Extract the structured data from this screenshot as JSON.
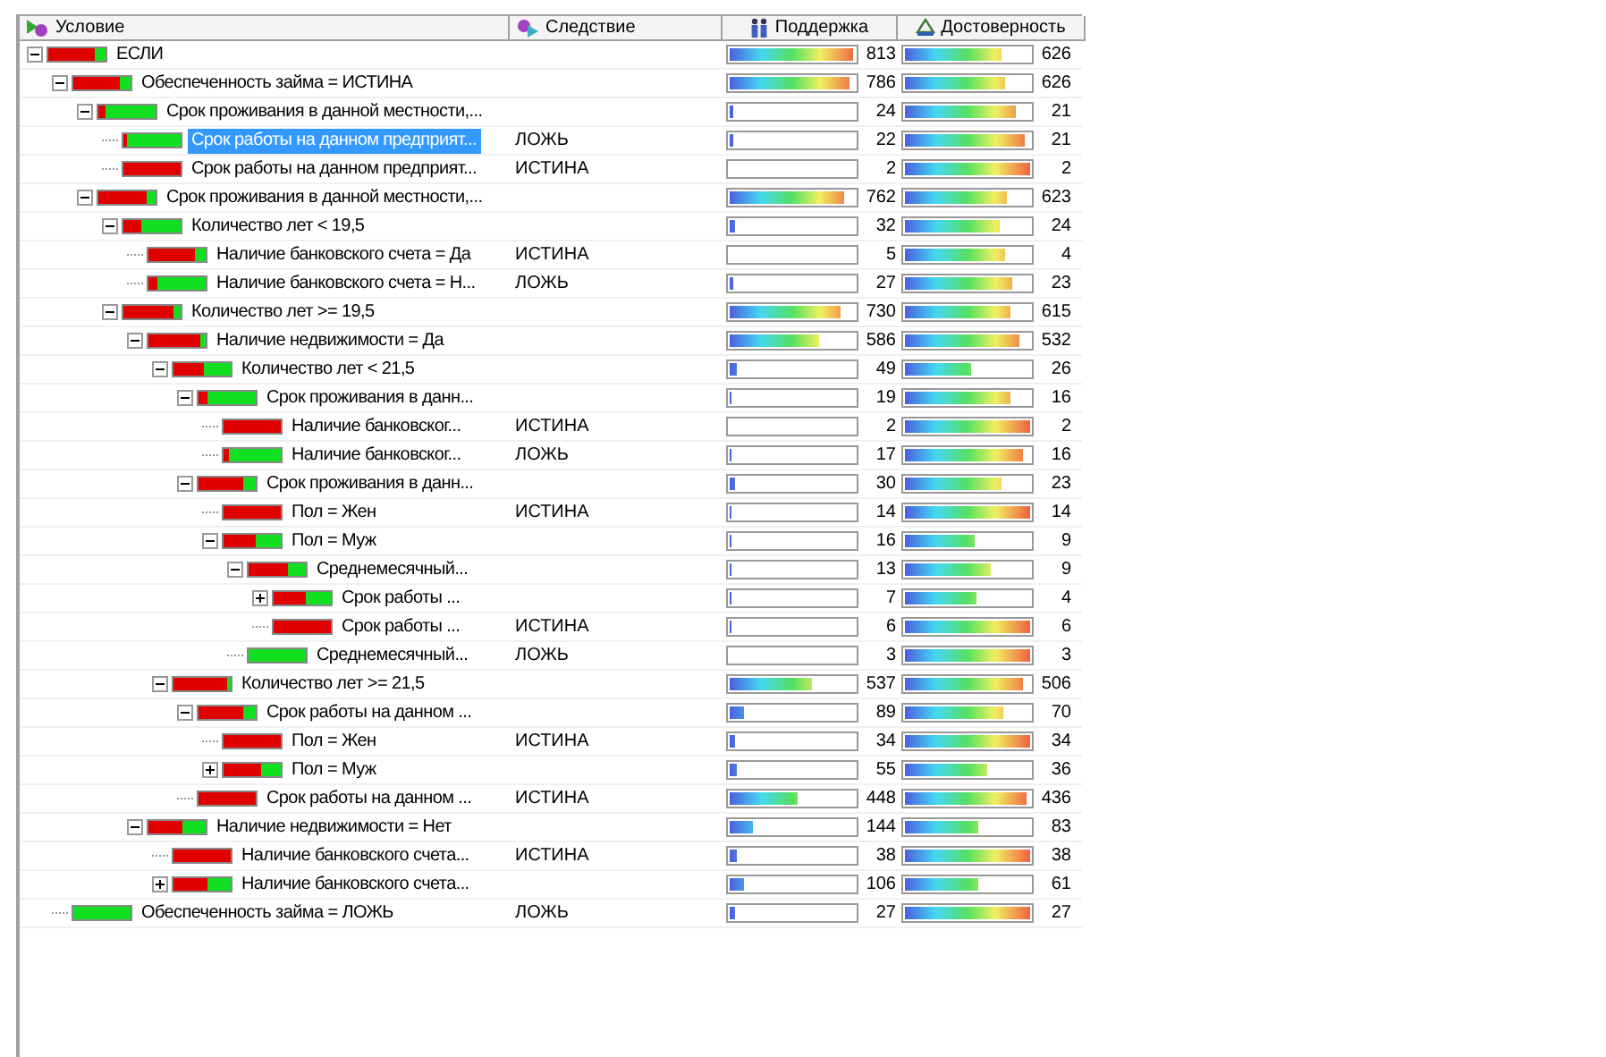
{
  "columns": [
    {
      "label": "Условие",
      "kind": "condition"
    },
    {
      "label": "Следствие",
      "kind": "consequence"
    },
    {
      "label": "Поддержка",
      "kind": "support"
    },
    {
      "label": "Достоверность",
      "kind": "confidence"
    }
  ],
  "tree": [
    {
      "label": "ЕСЛИ",
      "indicator": {
        "level": 0.8
      },
      "support": {
        "value": "813",
        "level": 0.98
      },
      "confidence": {
        "value": "626",
        "level": 0.77
      },
      "expanded": true,
      "selected": false,
      "children": [
        {
          "label": "Обеспеченность займа = ИСТИНА",
          "indicator": {
            "level": 0.82
          },
          "support": {
            "value": "786",
            "level": 0.95
          },
          "confidence": {
            "value": "626",
            "level": 0.8
          },
          "expanded": true,
          "selected": false,
          "children": [
            {
              "label": "Срок проживания в данной местности,...",
              "indicator": {
                "level": 0.12
              },
              "support": {
                "value": "24",
                "level": 0.03
              },
              "confidence": {
                "value": "21",
                "level": 0.88
              },
              "expanded": true,
              "selected": false,
              "children": [
                {
                  "label": "Срок работы на данном предприят...",
                  "consequence": "ЛОЖЬ",
                  "indicator": {
                    "level": 0.05
                  },
                  "support": {
                    "value": "22",
                    "level": 0.03
                  },
                  "confidence": {
                    "value": "21",
                    "level": 0.95
                  },
                  "selected": true
                },
                {
                  "label": "Срок работы на данном предприят...",
                  "consequence": "ИСТИНА",
                  "indicator": {
                    "level": 1
                  },
                  "support": {
                    "value": "2",
                    "level": 0
                  },
                  "confidence": {
                    "value": "2",
                    "level": 1
                  },
                  "selected": false
                }
              ]
            },
            {
              "label": "Срок проживания в данной местности,...",
              "indicator": {
                "level": 0.85
              },
              "support": {
                "value": "762",
                "level": 0.92
              },
              "confidence": {
                "value": "623",
                "level": 0.82
              },
              "expanded": true,
              "selected": false,
              "children": [
                {
                  "label": "Количество лет < 19,5",
                  "indicator": {
                    "level": 0.3
                  },
                  "support": {
                    "value": "32",
                    "level": 0.04
                  },
                  "confidence": {
                    "value": "24",
                    "level": 0.75
                  },
                  "expanded": true,
                  "selected": false,
                  "children": [
                    {
                      "label": "Наличие банковского счета = Да",
                      "consequence": "ИСТИНА",
                      "indicator": {
                        "level": 0.8
                      },
                      "support": {
                        "value": "5",
                        "level": 0
                      },
                      "confidence": {
                        "value": "4",
                        "level": 0.8
                      },
                      "selected": false
                    },
                    {
                      "label": "Наличие банковского счета = Н...",
                      "consequence": "ЛОЖЬ",
                      "indicator": {
                        "level": 0.15
                      },
                      "support": {
                        "value": "27",
                        "level": 0.03
                      },
                      "confidence": {
                        "value": "23",
                        "level": 0.85
                      },
                      "selected": false
                    }
                  ]
                },
                {
                  "label": "Количество лет >= 19,5",
                  "indicator": {
                    "level": 0.88
                  },
                  "support": {
                    "value": "730",
                    "level": 0.88
                  },
                  "confidence": {
                    "value": "615",
                    "level": 0.84
                  },
                  "expanded": true,
                  "selected": false,
                  "children": [
                    {
                      "label": "Наличие недвижимости = Да",
                      "indicator": {
                        "level": 0.92
                      },
                      "support": {
                        "value": "586",
                        "level": 0.72
                      },
                      "confidence": {
                        "value": "532",
                        "level": 0.91
                      },
                      "expanded": true,
                      "selected": false,
                      "children": [
                        {
                          "label": "Количество лет < 21,5",
                          "indicator": {
                            "level": 0.53
                          },
                          "support": {
                            "value": "49",
                            "level": 0.06
                          },
                          "confidence": {
                            "value": "26",
                            "level": 0.53
                          },
                          "expanded": true,
                          "selected": false,
                          "children": [
                            {
                              "label": "Срок проживания в данн...",
                              "indicator": {
                                "level": 0.16
                              },
                              "support": {
                                "value": "19",
                                "level": 0.02
                              },
                              "confidence": {
                                "value": "16",
                                "level": 0.84
                              },
                              "expanded": true,
                              "selected": false,
                              "children": [
                                {
                                  "label": "Наличие банковског...",
                                  "consequence": "ИСТИНА",
                                  "indicator": {
                                    "level": 1
                                  },
                                  "support": {
                                    "value": "2",
                                    "level": 0
                                  },
                                  "confidence": {
                                    "value": "2",
                                    "level": 1
                                  },
                                  "selected": false
                                },
                                {
                                  "label": "Наличие банковског...",
                                  "consequence": "ЛОЖЬ",
                                  "indicator": {
                                    "level": 0.08
                                  },
                                  "support": {
                                    "value": "17",
                                    "level": 0.02
                                  },
                                  "confidence": {
                                    "value": "16",
                                    "level": 0.94
                                  },
                                  "selected": false
                                }
                              ]
                            },
                            {
                              "label": "Срок проживания в данн...",
                              "indicator": {
                                "level": 0.77
                              },
                              "support": {
                                "value": "30",
                                "level": 0.04
                              },
                              "confidence": {
                                "value": "23",
                                "level": 0.77
                              },
                              "expanded": true,
                              "selected": false,
                              "children": [
                                {
                                  "label": "Пол = Жен",
                                  "consequence": "ИСТИНА",
                                  "indicator": {
                                    "level": 1
                                  },
                                  "support": {
                                    "value": "14",
                                    "level": 0.02
                                  },
                                  "confidence": {
                                    "value": "14",
                                    "level": 1
                                  },
                                  "selected": false
                                },
                                {
                                  "label": "Пол = Муж",
                                  "indicator": {
                                    "level": 0.56
                                  },
                                  "support": {
                                    "value": "16",
                                    "level": 0.02
                                  },
                                  "confidence": {
                                    "value": "9",
                                    "level": 0.56
                                  },
                                  "expanded": true,
                                  "selected": false,
                                  "children": [
                                    {
                                      "label": "Среднемесячный...",
                                      "indicator": {
                                        "level": 0.69
                                      },
                                      "support": {
                                        "value": "13",
                                        "level": 0.02
                                      },
                                      "confidence": {
                                        "value": "9",
                                        "level": 0.69
                                      },
                                      "expanded": true,
                                      "selected": false,
                                      "children": [
                                        {
                                          "label": "Срок работы ...",
                                          "indicator": {
                                            "level": 0.57
                                          },
                                          "support": {
                                            "value": "7",
                                            "level": 0.01
                                          },
                                          "confidence": {
                                            "value": "4",
                                            "level": 0.57
                                          },
                                          "expanded": false,
                                          "selected": false
                                        },
                                        {
                                          "label": "Срок работы ...",
                                          "consequence": "ИСТИНА",
                                          "indicator": {
                                            "level": 1
                                          },
                                          "support": {
                                            "value": "6",
                                            "level": 0.01
                                          },
                                          "confidence": {
                                            "value": "6",
                                            "level": 1
                                          },
                                          "selected": false
                                        }
                                      ]
                                    },
                                    {
                                      "label": "Среднемесячный...",
                                      "consequence": "ЛОЖЬ",
                                      "indicator": {
                                        "level": 0
                                      },
                                      "support": {
                                        "value": "3",
                                        "level": 0
                                      },
                                      "confidence": {
                                        "value": "3",
                                        "level": 1
                                      },
                                      "selected": false
                                    }
                                  ]
                                }
                              ]
                            }
                          ]
                        },
                        {
                          "label": "Количество лет >= 21,5",
                          "indicator": {
                            "level": 0.94
                          },
                          "support": {
                            "value": "537",
                            "level": 0.65
                          },
                          "confidence": {
                            "value": "506",
                            "level": 0.94
                          },
                          "expanded": true,
                          "selected": false,
                          "children": [
                            {
                              "label": "Срок работы на данном ...",
                              "indicator": {
                                "level": 0.79
                              },
                              "support": {
                                "value": "89",
                                "level": 0.11
                              },
                              "confidence": {
                                "value": "70",
                                "level": 0.79
                              },
                              "expanded": true,
                              "selected": false,
                              "children": [
                                {
                                  "label": "Пол = Жен",
                                  "consequence": "ИСТИНА",
                                  "indicator": {
                                    "level": 1
                                  },
                                  "support": {
                                    "value": "34",
                                    "level": 0.04
                                  },
                                  "confidence": {
                                    "value": "34",
                                    "level": 1
                                  },
                                  "selected": false
                                },
                                {
                                  "label": "Пол = Муж",
                                  "indicator": {
                                    "level": 0.65
                                  },
                                  "support": {
                                    "value": "55",
                                    "level": 0.06
                                  },
                                  "confidence": {
                                    "value": "36",
                                    "level": 0.65
                                  },
                                  "expanded": false,
                                  "selected": false
                                }
                              ]
                            },
                            {
                              "label": "Срок работы на данном ...",
                              "consequence": "ИСТИНА",
                              "indicator": {
                                "level": 1
                              },
                              "support": {
                                "value": "448",
                                "level": 0.54
                              },
                              "confidence": {
                                "value": "436",
                                "level": 0.97
                              },
                              "selected": false
                            }
                          ]
                        }
                      ]
                    },
                    {
                      "label": "Наличие недвижимости = Нет",
                      "indicator": {
                        "level": 0.58
                      },
                      "support": {
                        "value": "144",
                        "level": 0.18
                      },
                      "confidence": {
                        "value": "83",
                        "level": 0.58
                      },
                      "expanded": true,
                      "selected": false,
                      "children": [
                        {
                          "label": "Наличие банковского счета...",
                          "consequence": "ИСТИНА",
                          "indicator": {
                            "level": 1
                          },
                          "support": {
                            "value": "38",
                            "level": 0.05
                          },
                          "confidence": {
                            "value": "38",
                            "level": 1
                          },
                          "selected": false
                        },
                        {
                          "label": "Наличие банковского счета...",
                          "indicator": {
                            "level": 0.58
                          },
                          "support": {
                            "value": "106",
                            "level": 0.12
                          },
                          "confidence": {
                            "value": "61",
                            "level": 0.58
                          },
                          "expanded": false,
                          "selected": false
                        }
                      ]
                    }
                  ]
                }
              ]
            }
          ]
        },
        {
          "label": "Обеспеченность займа = ЛОЖЬ",
          "consequence": "ЛОЖЬ",
          "indicator": {
            "level": 0
          },
          "support": {
            "value": "27",
            "level": 0.04
          },
          "confidence": {
            "value": "27",
            "level": 1
          },
          "selected": false
        }
      ]
    }
  ]
}
